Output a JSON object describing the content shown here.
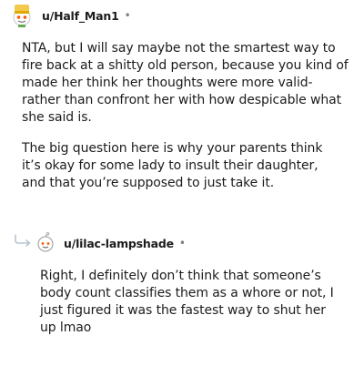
{
  "comment1": {
    "username": "u/Half_Man1",
    "separator": "•",
    "avatar_icon": "snoo-avatar-icon",
    "paragraphs": [
      "NTA, but I will say maybe not the smartest way to fire back at a shitty old person, because you kind of made her think her thoughts were more valid-rather than confront her with how despicable what she said is.",
      "The big question here is why your parents think it’s okay for some lady to insult their daughter, and that you’re supposed to just take it."
    ]
  },
  "reply": {
    "reply_icon": "reply-arrow-icon",
    "username": "u/lilac-lampshade",
    "separator": "•",
    "avatar_icon": "snoo-avatar-icon",
    "paragraphs": [
      "Right, I definitely don’t think that someone’s body count classifies them as a whore or not, I just figured it was the fastest way to shut her up lmao"
    ]
  },
  "colors": {
    "text": "#1c1c1c",
    "meta": "#7c7c7c",
    "reply_icon": "#b8c5cf"
  }
}
